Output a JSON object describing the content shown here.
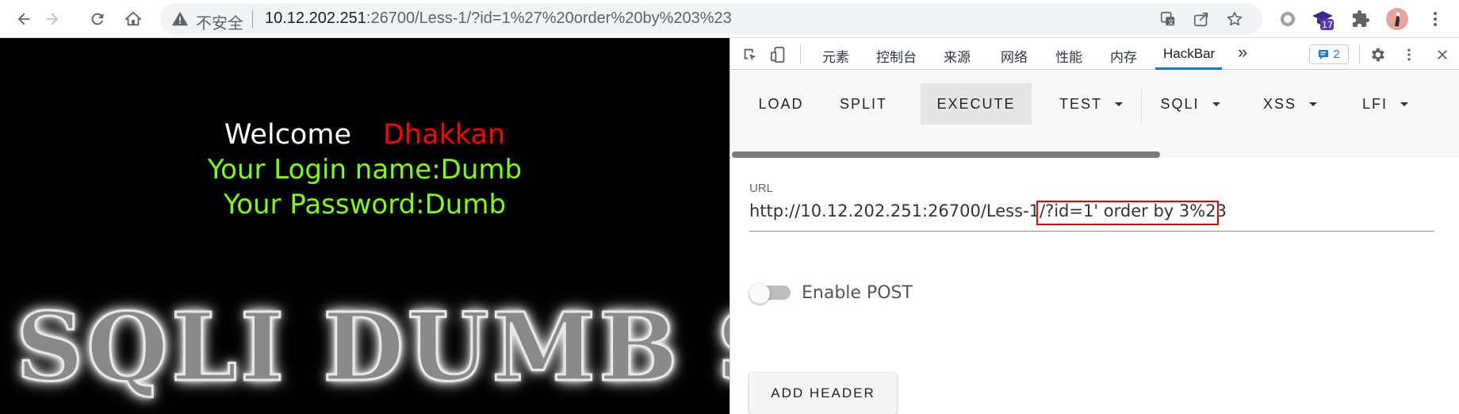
{
  "browser": {
    "insecure_label": "不安全",
    "url_host": "10.12.202.251",
    "url_rest": ":26700/Less-1/?id=1%27%20order%20by%203%23",
    "extension_badge": "17"
  },
  "page": {
    "welcome": "Welcome",
    "username": "Dhakkan",
    "login_line": "Your Login name:Dumb",
    "password_line": "Your Password:Dumb",
    "banner": "SQLI DUMB SE",
    "colors": {
      "welcome": "#ffffff",
      "username": "#ff0000",
      "login": "#7fff00"
    }
  },
  "devtools": {
    "tabs": [
      "元素",
      "控制台",
      "来源",
      "网络",
      "性能",
      "内存",
      "HackBar"
    ],
    "active_tab": "HackBar",
    "more": "»",
    "issues_count": "2"
  },
  "hackbar": {
    "buttons": {
      "load": "LOAD",
      "split": "SPLIT",
      "execute": "EXECUTE",
      "test": "TEST",
      "sqli": "SQLI",
      "xss": "XSS",
      "lfi": "LFI"
    },
    "url_label": "URL",
    "url_value": "http://10.12.202.251:26700/Less-1/?id=1' order by 3%23",
    "enable_post_label": "Enable POST",
    "add_header_label": "ADD HEADER"
  }
}
